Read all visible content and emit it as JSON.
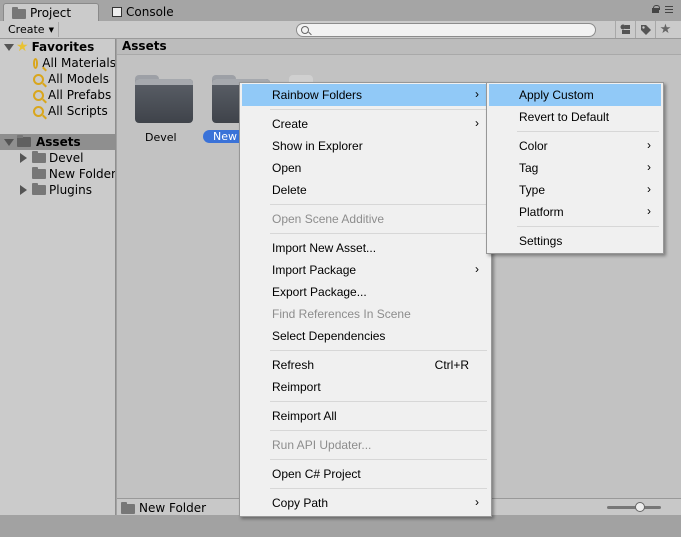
{
  "tabs": [
    {
      "label": "Project",
      "icon": "folder-icon"
    },
    {
      "label": "Console",
      "icon": "console-icon"
    }
  ],
  "toolbar": {
    "create_label": "Create",
    "search_placeholder": "",
    "icons": [
      "filter-by-type-icon",
      "filter-by-label-icon",
      "favorite-star-icon"
    ]
  },
  "tree": {
    "favorites_label": "Favorites",
    "favorites": [
      "All Materials",
      "All Models",
      "All Prefabs",
      "All Scripts"
    ],
    "assets_label": "Assets",
    "assets_children": [
      "Devel",
      "New Folder",
      "Plugins"
    ]
  },
  "assets_panel": {
    "header": "Assets",
    "folders": [
      {
        "label": "Devel",
        "selected": false
      },
      {
        "label": "New F",
        "selected": true
      }
    ],
    "bottom_path": "New Folder"
  },
  "context_menu": {
    "items": [
      {
        "label": "Rainbow Folders",
        "submenu": true,
        "highlighted": true
      },
      {
        "label": "Create",
        "submenu": true
      },
      {
        "label": "Show in Explorer"
      },
      {
        "label": "Open"
      },
      {
        "label": "Delete"
      },
      {
        "label": "Open Scene Additive",
        "disabled": true
      },
      {
        "label": "Import New Asset..."
      },
      {
        "label": "Import Package",
        "submenu": true
      },
      {
        "label": "Export Package..."
      },
      {
        "label": "Find References In Scene",
        "disabled": true
      },
      {
        "label": "Select Dependencies"
      },
      {
        "label": "Refresh",
        "shortcut": "Ctrl+R"
      },
      {
        "label": "Reimport"
      },
      {
        "label": "Reimport All"
      },
      {
        "label": "Run API Updater...",
        "disabled": true
      },
      {
        "label": "Open C# Project"
      },
      {
        "label": "Copy Path",
        "submenu": true
      }
    ]
  },
  "rainbow_submenu": {
    "items": [
      {
        "label": "Apply Custom",
        "highlighted": true
      },
      {
        "label": "Revert to Default"
      },
      {
        "label": "Color",
        "submenu": true
      },
      {
        "label": "Tag",
        "submenu": true
      },
      {
        "label": "Type",
        "submenu": true
      },
      {
        "label": "Platform",
        "submenu": true
      },
      {
        "label": "Settings"
      }
    ]
  },
  "colors": {
    "highlight": "#91c9f7",
    "selection_blue": "#3a72d8",
    "favorite_star": "#e8c233"
  }
}
